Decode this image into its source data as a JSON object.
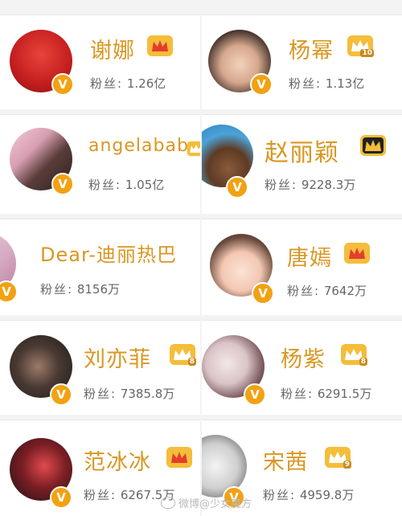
{
  "profiles": [
    {
      "name": "谢娜",
      "fans_label": "粉丝:",
      "fans_value": "1.26亿",
      "crown": "gold-red",
      "level": ""
    },
    {
      "name": "杨幂",
      "fans_label": "粉丝:",
      "fans_value": "1.13亿",
      "crown": "gold-level",
      "level": "10"
    },
    {
      "name": "angelababy",
      "fans_label": "粉丝:",
      "fans_value": "1.05亿",
      "crown": "gold-level",
      "level": ""
    },
    {
      "name": "赵丽颖",
      "fans_label": "粉丝:",
      "fans_value": "9228.3万",
      "crown": "black-gold",
      "level": ""
    },
    {
      "name": "Dear-迪丽热巴",
      "fans_label": "粉丝:",
      "fans_value": "8156万",
      "crown": "none",
      "level": ""
    },
    {
      "name": "唐嫣",
      "fans_label": "粉丝:",
      "fans_value": "7642万",
      "crown": "gold-red",
      "level": ""
    },
    {
      "name": "刘亦菲",
      "fans_label": "粉丝:",
      "fans_value": "7385.8万",
      "crown": "gold-level",
      "level": "8"
    },
    {
      "name": "杨紫",
      "fans_label": "粉丝:",
      "fans_value": "6291.5万",
      "crown": "gold-level",
      "level": "8"
    },
    {
      "name": "范冰冰",
      "fans_label": "粉丝:",
      "fans_value": "6267.5万",
      "crown": "gold-red",
      "level": ""
    },
    {
      "name": "宋茜",
      "fans_label": "粉丝:",
      "fans_value": "4959.8万",
      "crown": "gold-level",
      "level": "9"
    }
  ],
  "verified_mark": "V",
  "watermark": "微博@少女魔方",
  "colors": {
    "name": "#d99722",
    "badge": "#f2a112",
    "fans": "#666666"
  }
}
